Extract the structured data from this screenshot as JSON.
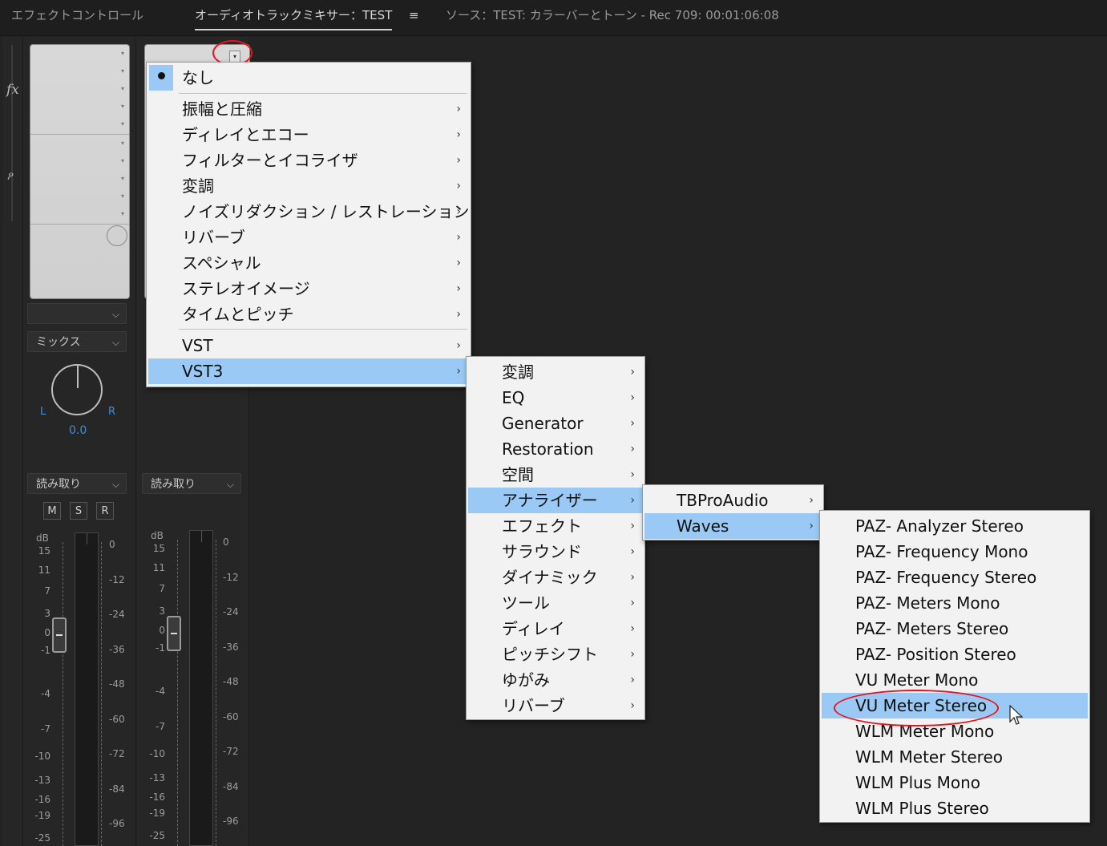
{
  "tabs": [
    {
      "label": "エフェクトコントロール"
    },
    {
      "label": "オーディオトラックミキサー：TEST"
    },
    {
      "label": "ソース：TEST: カラーバーとトーン - Rec 709: 00:01:06:08"
    }
  ],
  "panel_menu_icon": "hamburger-icon",
  "mixer": {
    "fx_label": "fx",
    "mix_dropdown": "ミックス",
    "pan_left": "L",
    "pan_right": "R",
    "pan_value": "0.0",
    "automation_1": "読み取り",
    "automation_2": "読み取り",
    "mute": "M",
    "solo": "S",
    "record": "R",
    "db_label": "dB",
    "left_scale": [
      "15",
      "11",
      "7",
      "3",
      "0",
      "-1",
      "-4",
      "-7",
      "-10",
      "-13",
      "-16",
      "-19",
      "-25"
    ],
    "right_scale": [
      "0",
      "-12",
      "-24",
      "-36",
      "-48",
      "-60",
      "-72",
      "-84",
      "-96"
    ]
  },
  "menu1": {
    "selected": "なし",
    "items": [
      "振幅と圧縮",
      "ディレイとエコー",
      "フィルターとイコライザ",
      "変調",
      "ノイズリダクション / レストレーション",
      "リバーブ",
      "スペシャル",
      "ステレオイメージ",
      "タイムとピッチ"
    ],
    "plugin_items": [
      "VST",
      "VST3"
    ]
  },
  "menu2": {
    "items": [
      "変調",
      "EQ",
      "Generator",
      "Restoration",
      "空間",
      "アナライザー",
      "エフェクト",
      "サラウンド",
      "ダイナミック",
      "ツール",
      "ディレイ",
      "ピッチシフト",
      "ゆがみ",
      "リバーブ"
    ]
  },
  "menu3": {
    "items": [
      "TBProAudio",
      "Waves"
    ]
  },
  "menu4": {
    "items": [
      "PAZ- Analyzer Stereo",
      "PAZ- Frequency Mono",
      "PAZ- Frequency Stereo",
      "PAZ- Meters Mono",
      "PAZ- Meters Stereo",
      "PAZ- Position Stereo",
      "VU Meter Mono",
      "VU Meter Stereo",
      "WLM Meter Mono",
      "WLM Meter Stereo",
      "WLM Plus Mono",
      "WLM Plus Stereo"
    ]
  },
  "colors": {
    "highlight": "#99c9f4",
    "annotation": "#e8141b",
    "pan_blue": "#3a8fdc"
  }
}
